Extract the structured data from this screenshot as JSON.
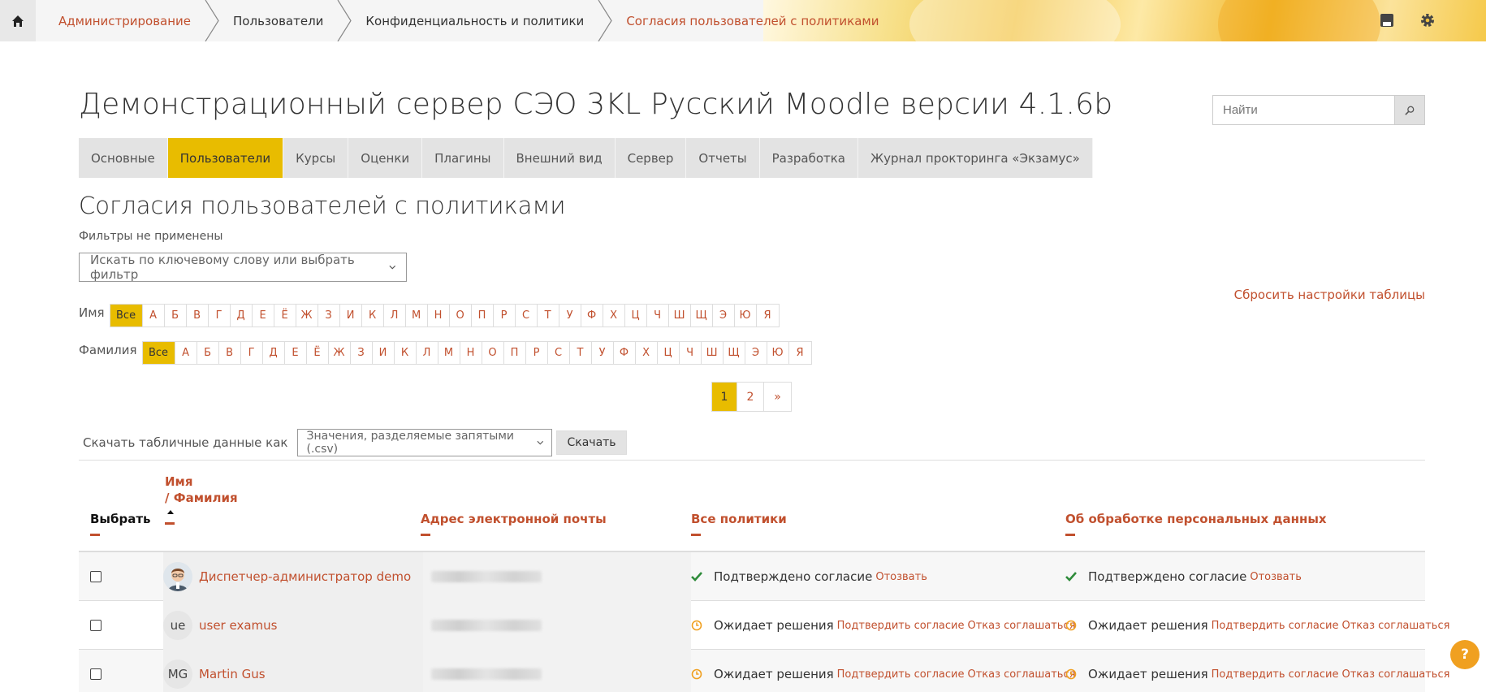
{
  "breadcrumb": [
    "Администрирование",
    "Пользователи",
    "Конфиденциальность и политики",
    "Согласия пользователей с политиками"
  ],
  "site_title": "Демонстрационный сервер СЭО 3KL Русский Moodle версии 4.1.6b",
  "search": {
    "placeholder": "Найти"
  },
  "nav": [
    "Основные",
    "Пользователи",
    "Курсы",
    "Оценки",
    "Плагины",
    "Внешний вид",
    "Сервер",
    "Отчеты",
    "Разработка",
    "Журнал прокторинга «Экзамус»"
  ],
  "page_title": "Согласия пользователей с политиками",
  "filters_note": "Фильтры не применены",
  "filter_placeholder": "Искать по ключевому слову или выбрать фильтр",
  "reset_link": "Сбросить настройки таблицы",
  "firstname_label": "Имя",
  "lastname_label": "Фамилия",
  "letters": [
    "Все",
    "А",
    "Б",
    "В",
    "Г",
    "Д",
    "Е",
    "Ё",
    "Ж",
    "З",
    "И",
    "К",
    "Л",
    "М",
    "Н",
    "О",
    "П",
    "Р",
    "С",
    "Т",
    "У",
    "Ф",
    "Х",
    "Ц",
    "Ч",
    "Ш",
    "Щ",
    "Э",
    "Ю",
    "Я"
  ],
  "pager": [
    "1",
    "2",
    "»"
  ],
  "download": {
    "label": "Скачать табличные данные как",
    "format": "Значения, разделяемые запятыми (.csv)",
    "button": "Скачать"
  },
  "table": {
    "col_select": "Выбрать",
    "col_firstname": "Имя",
    "col_lastname": "/ Фамилия",
    "col_email": "Адрес электронной почты",
    "col_all": "Все политики",
    "col_personal": "Об обработке персональных данных",
    "rows": [
      {
        "initials": "",
        "name": "Диспетчер-администратор demo",
        "status": "Подтверждено согласие",
        "actions": [
          "Отозвать"
        ],
        "status2": "Подтверждено согласие",
        "actions2": [
          "Отозвать"
        ]
      },
      {
        "initials": "ue",
        "name": "user examus",
        "status": "Ожидает решения",
        "actions": [
          "Подтвердить согласие",
          "Отказ соглашаться"
        ],
        "status2": "Ожидает решения",
        "actions2": [
          "Подтвердить согласие",
          "Отказ соглашаться"
        ]
      },
      {
        "initials": "MG",
        "name": "Martin Gus",
        "status": "Ожидает решения",
        "actions": [
          "Подтвердить согласие",
          "Отказ соглашаться"
        ],
        "status2": "Ожидает решения",
        "actions2": [
          "Подтвердить согласие",
          "Отказ соглашаться"
        ]
      }
    ]
  },
  "help": "?",
  "colors": {
    "accent": "#e8bc00",
    "link": "#c1502e"
  }
}
